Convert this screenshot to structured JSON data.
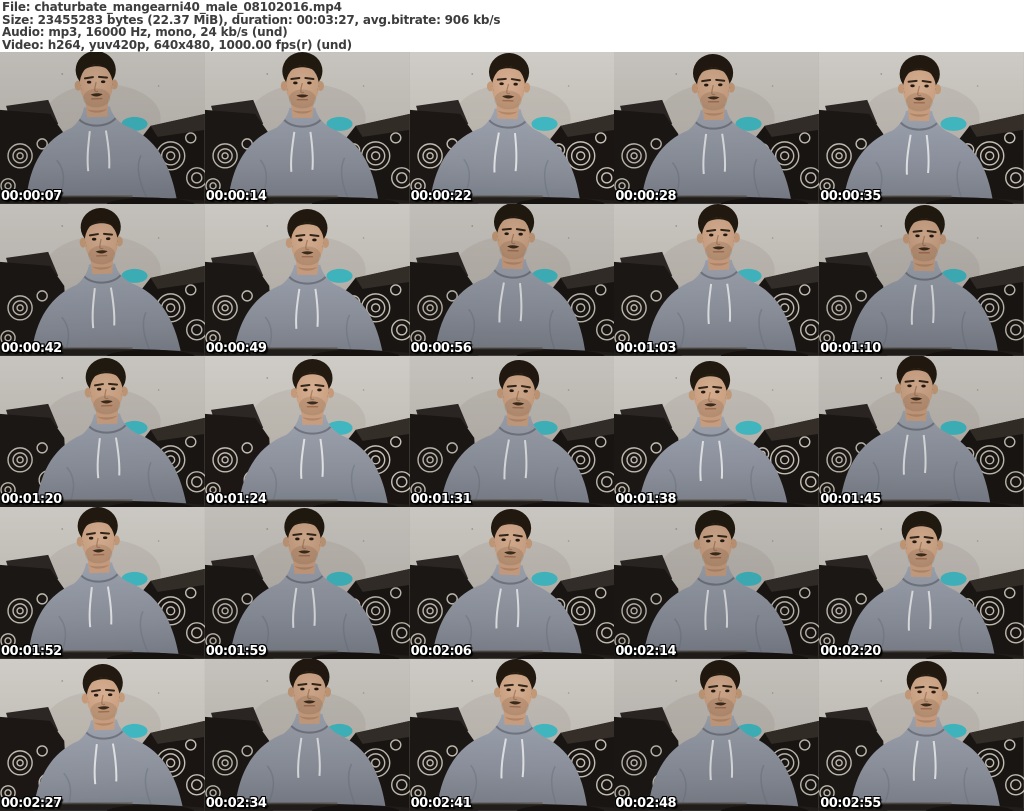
{
  "header": {
    "lines": [
      "File: chaturbate_mangearni40_male_08102016.mp4",
      "Size: 23455283 bytes (22.37 MiB), duration: 00:03:27, avg.bitrate: 906 kb/s",
      "Audio: mp3, 16000 Hz, mono, 24 kb/s (und)",
      "Video: h264, yuv420p, 640x480, 1000.00 fps(r) (und)"
    ],
    "file_name": "chaturbate_mangearni40_male_08102016.mp4",
    "size_bytes": "23455283",
    "size_human": "22.37 MiB",
    "duration": "00:03:27",
    "avg_bitrate": "906 kb/s",
    "audio": {
      "codec": "mp3",
      "sample_rate": "16000 Hz",
      "channels": "mono",
      "bitrate": "24 kb/s",
      "language": "und"
    },
    "video": {
      "codec": "h264",
      "pixel_format": "yuv420p",
      "resolution": "640x480",
      "framerate": "1000.00 fps(r)",
      "language": "und"
    }
  },
  "grid": {
    "rows": 5,
    "columns": 5,
    "thumbnail_count": 25,
    "timestamps": [
      "00:00:07",
      "00:00:14",
      "00:00:22",
      "00:00:28",
      "00:00:35",
      "00:00:42",
      "00:00:49",
      "00:00:56",
      "00:01:03",
      "00:01:10",
      "00:01:20",
      "00:01:24",
      "00:01:31",
      "00:01:38",
      "00:01:45",
      "00:01:52",
      "00:01:59",
      "00:02:06",
      "00:02:14",
      "00:02:20",
      "00:02:27",
      "00:02:34",
      "00:02:41",
      "00:02:48",
      "00:02:55"
    ]
  },
  "colors": {
    "header_background": "#ffffff",
    "header_text": "#3d3d3d",
    "timestamp_text": "#ffffff",
    "timestamp_outline": "#000000",
    "wall_gray": "#bdb9b2",
    "hoodie_gray": "#8b909b",
    "couch_dark": "#1a1613",
    "couch_pattern": "#d2ccc0",
    "teal_cushion": "#3fb3bc"
  }
}
